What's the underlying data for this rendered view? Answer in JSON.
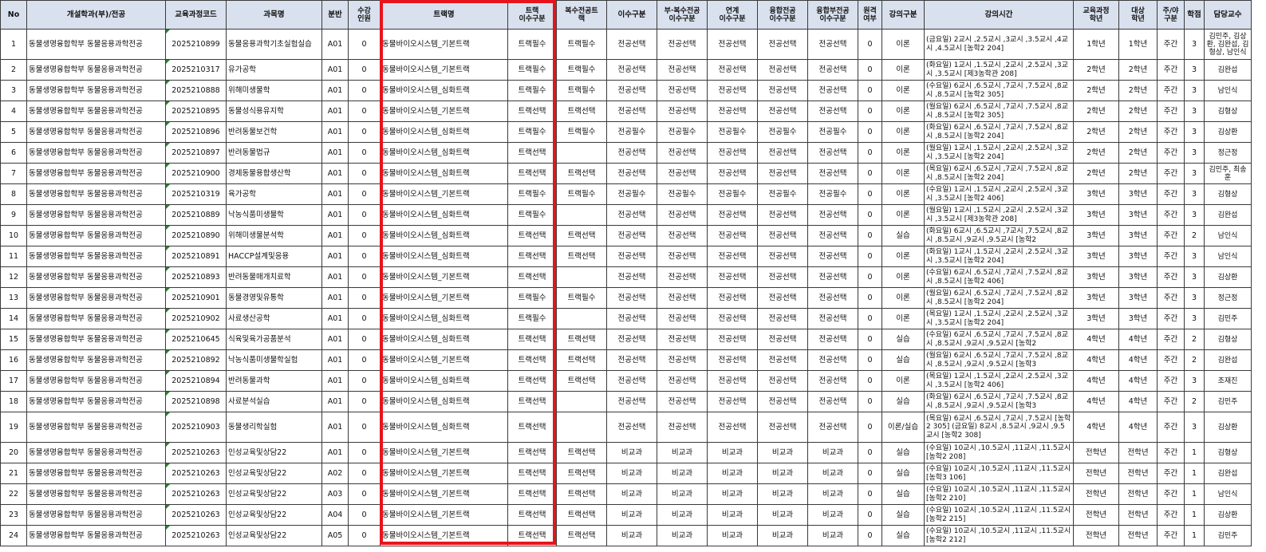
{
  "headers": [
    "No",
    "개설학과(부)/전공",
    "교육과정코드",
    "과목명",
    "분반",
    "수강\n인원",
    "트랙명",
    "트랙\n이수구분",
    "복수전공트\n랙",
    "이수구분",
    "부·복수전공\n이수구분",
    "연계\n이수구분",
    "융합전공\n이수구분",
    "융합부전공\n이수구분",
    "원격\n여부",
    "강의구분",
    "강의시간",
    "교육과정\n학년",
    "대상\n학년",
    "주/야\n구분",
    "학점",
    "담당교수"
  ],
  "rows": [
    {
      "no": "1",
      "dept": "동물생명융합학부 동물응용과학전공",
      "code": "2025210899",
      "subject": "동물응용과학기초실험실습",
      "section": "A01",
      "enroll": "0",
      "track": "동물바이오시스템_기본트랙",
      "track_type": "트랙필수",
      "dual_track": "트랙필수",
      "type": "전공선택",
      "minor_type": "전공선택",
      "linked_type": "전공선택",
      "fusion_type": "전공선택",
      "fusion_minor_type": "전공선택",
      "remote": "0",
      "lecture_type": "이론",
      "time": "(금요일) 2교시 ,2.5교시 ,3교시 ,3.5교시 ,4교시 ,4.5교시 [농학2 204]",
      "curr_year": "1학년",
      "target_year": "1학년",
      "daynight": "주간",
      "credit": "3",
      "professor": "김민주, 김상환, 김완섭, 김형상, 남인식"
    },
    {
      "no": "2",
      "dept": "동물생명융합학부 동물응용과학전공",
      "code": "2025210317",
      "subject": "유가공학",
      "section": "A01",
      "enroll": "0",
      "track": "동물바이오시스템_기본트랙",
      "track_type": "트랙필수",
      "dual_track": "트랙필수",
      "type": "전공선택",
      "minor_type": "전공선택",
      "linked_type": "전공선택",
      "fusion_type": "전공선택",
      "fusion_minor_type": "전공선택",
      "remote": "0",
      "lecture_type": "이론",
      "time": "(화요일) 1교시 ,1.5교시 ,2교시 ,2.5교시 ,3교시 ,3.5교시 [제3농학관 208]",
      "curr_year": "2학년",
      "target_year": "2학년",
      "daynight": "주간",
      "credit": "3",
      "professor": "김완섭"
    },
    {
      "no": "3",
      "dept": "동물생명융합학부 동물응용과학전공",
      "code": "2025210888",
      "subject": "위해미생물학",
      "section": "A01",
      "enroll": "0",
      "track": "동물바이오시스템_심화트랙",
      "track_type": "트랙필수",
      "dual_track": "트랙필수",
      "type": "전공선택",
      "minor_type": "전공선택",
      "linked_type": "전공선택",
      "fusion_type": "전공선택",
      "fusion_minor_type": "전공선택",
      "remote": "0",
      "lecture_type": "이론",
      "time": "(수요일) 6교시 ,6.5교시 ,7교시 ,7.5교시 ,8교시 ,8.5교시 [농학2 305]",
      "curr_year": "2학년",
      "target_year": "2학년",
      "daynight": "주간",
      "credit": "3",
      "professor": "남인식"
    },
    {
      "no": "4",
      "dept": "동물생명융합학부 동물응용과학전공",
      "code": "2025210895",
      "subject": "동물성식용유지학",
      "section": "A01",
      "enroll": "0",
      "track": "동물바이오시스템_기본트랙",
      "track_type": "트랙선택",
      "dual_track": "트랙선택",
      "type": "전공선택",
      "minor_type": "전공선택",
      "linked_type": "전공선택",
      "fusion_type": "전공선택",
      "fusion_minor_type": "전공선택",
      "remote": "0",
      "lecture_type": "이론",
      "time": "(월요일) 6교시 ,6.5교시 ,7교시 ,7.5교시 ,8교시 ,8.5교시 [농학2 305]",
      "curr_year": "2학년",
      "target_year": "2학년",
      "daynight": "주간",
      "credit": "3",
      "professor": "김형상"
    },
    {
      "no": "5",
      "dept": "동물생명융합학부 동물응용과학전공",
      "code": "2025210896",
      "subject": "반려동물보건학",
      "section": "A01",
      "enroll": "0",
      "track": "동물바이오시스템_심화트랙",
      "track_type": "트랙필수",
      "dual_track": "트랙필수",
      "type": "전공필수",
      "minor_type": "전공필수",
      "linked_type": "전공필수",
      "fusion_type": "전공필수",
      "fusion_minor_type": "전공필수",
      "remote": "0",
      "lecture_type": "이론",
      "time": "(화요일) 6교시 ,6.5교시 ,7교시 ,7.5교시 ,8교시 ,8.5교시 [농학2 204]",
      "curr_year": "2학년",
      "target_year": "2학년",
      "daynight": "주간",
      "credit": "3",
      "professor": "김상환"
    },
    {
      "no": "6",
      "dept": "동물생명융합학부 동물응용과학전공",
      "code": "2025210897",
      "subject": "반려동물법규",
      "section": "A01",
      "enroll": "0",
      "track": "동물바이오시스템_심화트랙",
      "track_type": "트랙선택",
      "dual_track": "",
      "type": "전공선택",
      "minor_type": "전공선택",
      "linked_type": "전공선택",
      "fusion_type": "전공선택",
      "fusion_minor_type": "전공선택",
      "remote": "0",
      "lecture_type": "이론",
      "time": "(월요일) 1교시 ,1.5교시 ,2교시 ,2.5교시 ,3교시 ,3.5교시 [농학2 204]",
      "curr_year": "2학년",
      "target_year": "2학년",
      "daynight": "주간",
      "credit": "3",
      "professor": "정근정"
    },
    {
      "no": "7",
      "dept": "동물생명융합학부 동물응용과학전공",
      "code": "2025210900",
      "subject": "경제동물용합생산학",
      "section": "A01",
      "enroll": "0",
      "track": "동물바이오시스템_심화트랙",
      "track_type": "트랙선택",
      "dual_track": "트랙선택",
      "type": "전공선택",
      "minor_type": "전공선택",
      "linked_type": "전공선택",
      "fusion_type": "전공선택",
      "fusion_minor_type": "전공선택",
      "remote": "0",
      "lecture_type": "이론",
      "time": "(목요일) 6교시 ,6.5교시 ,7교시 ,7.5교시 ,8교시 ,8.5교시 [농학2 204]",
      "curr_year": "2학년",
      "target_year": "2학년",
      "daynight": "주간",
      "credit": "3",
      "professor": "김민주, 최송훈"
    },
    {
      "no": "8",
      "dept": "동물생명융합학부 동물응용과학전공",
      "code": "2025210319",
      "subject": "육가공학",
      "section": "A01",
      "enroll": "0",
      "track": "동물바이오시스템_기본트랙",
      "track_type": "트랙필수",
      "dual_track": "트랙필수",
      "type": "전공필수",
      "minor_type": "전공필수",
      "linked_type": "전공필수",
      "fusion_type": "전공필수",
      "fusion_minor_type": "전공필수",
      "remote": "0",
      "lecture_type": "이론",
      "time": "(수요일) 1교시 ,1.5교시 ,2교시 ,2.5교시 ,3교시 ,3.5교시 [농학2 406]",
      "curr_year": "3학년",
      "target_year": "3학년",
      "daynight": "주간",
      "credit": "3",
      "professor": "김형상"
    },
    {
      "no": "9",
      "dept": "동물생명융합학부 동물응용과학전공",
      "code": "2025210889",
      "subject": "낙농식품미생물학",
      "section": "A01",
      "enroll": "0",
      "track": "동물바이오시스템_심화트랙",
      "track_type": "트랙필수",
      "dual_track": "",
      "type": "전공선택",
      "minor_type": "전공선택",
      "linked_type": "전공선택",
      "fusion_type": "전공선택",
      "fusion_minor_type": "전공선택",
      "remote": "0",
      "lecture_type": "이론",
      "time": "(월요일) 1교시 ,1.5교시 ,2교시 ,2.5교시 ,3교시 ,3.5교시 [제3농학관 208]",
      "curr_year": "3학년",
      "target_year": "3학년",
      "daynight": "주간",
      "credit": "3",
      "professor": "김완섭"
    },
    {
      "no": "10",
      "dept": "동물생명융합학부 동물응용과학전공",
      "code": "2025210890",
      "subject": "위해미생물분석학",
      "section": "A01",
      "enroll": "0",
      "track": "동물바이오시스템_심화트랙",
      "track_type": "트랙선택",
      "dual_track": "트랙선택",
      "type": "전공선택",
      "minor_type": "전공선택",
      "linked_type": "전공선택",
      "fusion_type": "전공선택",
      "fusion_minor_type": "전공선택",
      "remote": "0",
      "lecture_type": "실습",
      "time": "(화요일) 6교시 ,6.5교시 ,7교시 ,7.5교시 ,8교시 ,8.5교시 ,9교시 ,9.5교시 [농학2",
      "curr_year": "3학년",
      "target_year": "3학년",
      "daynight": "주간",
      "credit": "2",
      "professor": "남인식"
    },
    {
      "no": "11",
      "dept": "동물생명융합학부 동물응용과학전공",
      "code": "2025210891",
      "subject": "HACCP설계및응용",
      "section": "A01",
      "enroll": "0",
      "track": "동물바이오시스템_심화트랙",
      "track_type": "트랙선택",
      "dual_track": "트랙선택",
      "type": "전공선택",
      "minor_type": "전공선택",
      "linked_type": "전공선택",
      "fusion_type": "전공선택",
      "fusion_minor_type": "전공선택",
      "remote": "0",
      "lecture_type": "이론",
      "time": "(화요일) 1교시 ,1.5교시 ,2교시 ,2.5교시 ,3교시 ,3.5교시 [농학2 204]",
      "curr_year": "3학년",
      "target_year": "3학년",
      "daynight": "주간",
      "credit": "3",
      "professor": "남인식"
    },
    {
      "no": "12",
      "dept": "동물생명융합학부 동물응용과학전공",
      "code": "2025210893",
      "subject": "반려동물매개치료학",
      "section": "A01",
      "enroll": "0",
      "track": "동물바이오시스템_기본트랙",
      "track_type": "트랙선택",
      "dual_track": "",
      "type": "전공선택",
      "minor_type": "전공선택",
      "linked_type": "전공선택",
      "fusion_type": "전공선택",
      "fusion_minor_type": "전공선택",
      "remote": "0",
      "lecture_type": "이론",
      "time": "(수요일) 6교시 ,6.5교시 ,7교시 ,7.5교시 ,8교시 ,8.5교시 [농학2 406]",
      "curr_year": "3학년",
      "target_year": "3학년",
      "daynight": "주간",
      "credit": "3",
      "professor": "김상환"
    },
    {
      "no": "13",
      "dept": "동물생명융합학부 동물응용과학전공",
      "code": "2025210901",
      "subject": "동물경영및유통학",
      "section": "A01",
      "enroll": "0",
      "track": "동물바이오시스템_기본트랙",
      "track_type": "트랙필수",
      "dual_track": "트랙필수",
      "type": "전공선택",
      "minor_type": "전공선택",
      "linked_type": "전공선택",
      "fusion_type": "전공선택",
      "fusion_minor_type": "전공선택",
      "remote": "0",
      "lecture_type": "이론",
      "time": "(월요일) 6교시 ,6.5교시 ,7교시 ,7.5교시 ,8교시 ,8.5교시 [농학2 204]",
      "curr_year": "3학년",
      "target_year": "3학년",
      "daynight": "주간",
      "credit": "3",
      "professor": "정근정"
    },
    {
      "no": "14",
      "dept": "동물생명융합학부 동물응용과학전공",
      "code": "2025210902",
      "subject": "사료생산공학",
      "section": "A01",
      "enroll": "0",
      "track": "동물바이오시스템_심화트랙",
      "track_type": "트랙필수",
      "dual_track": "",
      "type": "전공선택",
      "minor_type": "전공선택",
      "linked_type": "전공선택",
      "fusion_type": "전공선택",
      "fusion_minor_type": "전공선택",
      "remote": "0",
      "lecture_type": "이론",
      "time": "(목요일) 1교시 ,1.5교시 ,2교시 ,2.5교시 ,3교시 ,3.5교시 [농학2 204]",
      "curr_year": "3학년",
      "target_year": "3학년",
      "daynight": "주간",
      "credit": "3",
      "professor": "김민주"
    },
    {
      "no": "15",
      "dept": "동물생명융합학부 동물응용과학전공",
      "code": "2025210645",
      "subject": "식육및육가공품분석",
      "section": "A01",
      "enroll": "0",
      "track": "동물바이오시스템_심화트랙",
      "track_type": "트랙선택",
      "dual_track": "트랙선택",
      "type": "전공선택",
      "minor_type": "전공선택",
      "linked_type": "전공선택",
      "fusion_type": "전공선택",
      "fusion_minor_type": "전공선택",
      "remote": "0",
      "lecture_type": "실습",
      "time": "(수요일) 6교시 ,6.5교시 ,7교시 ,7.5교시 ,8교시 ,8.5교시 ,9교시 ,9.5교시 [농학2",
      "curr_year": "4학년",
      "target_year": "4학년",
      "daynight": "주간",
      "credit": "2",
      "professor": "김형상"
    },
    {
      "no": "16",
      "dept": "동물생명융합학부 동물응용과학전공",
      "code": "2025210892",
      "subject": "낙농식품미생물학실험",
      "section": "A01",
      "enroll": "0",
      "track": "동물바이오시스템_기본트랙",
      "track_type": "트랙선택",
      "dual_track": "트랙선택",
      "type": "전공선택",
      "minor_type": "전공선택",
      "linked_type": "전공선택",
      "fusion_type": "전공선택",
      "fusion_minor_type": "전공선택",
      "remote": "0",
      "lecture_type": "실습",
      "time": "(월요일) 6교시 ,6.5교시 ,7교시 ,7.5교시 ,8교시 ,8.5교시 ,9교시 ,9.5교시 [농학3",
      "curr_year": "4학년",
      "target_year": "4학년",
      "daynight": "주간",
      "credit": "2",
      "professor": "김완섭"
    },
    {
      "no": "17",
      "dept": "동물생명융합학부 동물응용과학전공",
      "code": "2025210894",
      "subject": "반려동물과학",
      "section": "A01",
      "enroll": "0",
      "track": "동물바이오시스템_심화트랙",
      "track_type": "트랙선택",
      "dual_track": "트랙선택",
      "type": "전공선택",
      "minor_type": "전공선택",
      "linked_type": "전공선택",
      "fusion_type": "전공선택",
      "fusion_minor_type": "전공선택",
      "remote": "0",
      "lecture_type": "이론",
      "time": "(목요일) 1교시 ,1.5교시 ,2교시 ,2.5교시 ,3교시 ,3.5교시 [농학2 406]",
      "curr_year": "4학년",
      "target_year": "4학년",
      "daynight": "주간",
      "credit": "3",
      "professor": "조재진"
    },
    {
      "no": "18",
      "dept": "동물생명융합학부 동물응용과학전공",
      "code": "2025210898",
      "subject": "사료분석실습",
      "section": "A01",
      "enroll": "0",
      "track": "동물바이오시스템_심화트랙",
      "track_type": "트랙선택",
      "dual_track": "",
      "type": "전공선택",
      "minor_type": "전공선택",
      "linked_type": "전공선택",
      "fusion_type": "전공선택",
      "fusion_minor_type": "전공선택",
      "remote": "0",
      "lecture_type": "실습",
      "time": "(화요일) 6교시 ,6.5교시 ,7교시 ,7.5교시 ,8교시 ,8.5교시 ,9교시 ,9.5교시 [농학3",
      "curr_year": "4학년",
      "target_year": "4학년",
      "daynight": "주간",
      "credit": "2",
      "professor": "김민주"
    },
    {
      "no": "19",
      "dept": "동물생명융합학부 동물응용과학전공",
      "code": "2025210903",
      "subject": "동물생리학실험",
      "section": "A01",
      "enroll": "0",
      "track": "동물바이오시스템_심화트랙",
      "track_type": "트랙선택",
      "dual_track": "",
      "type": "전공선택",
      "minor_type": "전공선택",
      "linked_type": "전공선택",
      "fusion_type": "전공선택",
      "fusion_minor_type": "전공선택",
      "remote": "0",
      "lecture_type": "이론/실습",
      "time": "(목요일) 6교시 ,6.5교시 ,7교시 ,7.5교시 [농학2 305] (금요일) 8교시 ,8.5교시 ,9교시 ,9.5교시 [농학2 308]",
      "curr_year": "4학년",
      "target_year": "4학년",
      "daynight": "주간",
      "credit": "3",
      "professor": "김상환"
    },
    {
      "no": "20",
      "dept": "동물생명융합학부 동물응용과학전공",
      "code": "2025210263",
      "subject": "인성교육및상담22",
      "section": "A01",
      "enroll": "0",
      "track": "동물바이오시스템_기본트랙",
      "track_type": "트랙선택",
      "dual_track": "트랙선택",
      "type": "비교과",
      "minor_type": "비교과",
      "linked_type": "비교과",
      "fusion_type": "비교과",
      "fusion_minor_type": "비교과",
      "remote": "0",
      "lecture_type": "실습",
      "time": "(수요일) 10교시 ,10.5교시 ,11교시 ,11.5교시 [농학2 208]",
      "curr_year": "전학년",
      "target_year": "전학년",
      "daynight": "주간",
      "credit": "1",
      "professor": "김형상"
    },
    {
      "no": "21",
      "dept": "동물생명융합학부 동물응용과학전공",
      "code": "2025210263",
      "subject": "인성교육및상담22",
      "section": "A02",
      "enroll": "0",
      "track": "동물바이오시스템_기본트랙",
      "track_type": "트랙선택",
      "dual_track": "트랙선택",
      "type": "비교과",
      "minor_type": "비교과",
      "linked_type": "비교과",
      "fusion_type": "비교과",
      "fusion_minor_type": "비교과",
      "remote": "0",
      "lecture_type": "실습",
      "time": "(수요일) 10교시 ,10.5교시 ,11교시 ,11.5교시 [농학3 106]",
      "curr_year": "전학년",
      "target_year": "전학년",
      "daynight": "주간",
      "credit": "1",
      "professor": "김완섭"
    },
    {
      "no": "22",
      "dept": "동물생명융합학부 동물응용과학전공",
      "code": "2025210263",
      "subject": "인성교육및상담22",
      "section": "A03",
      "enroll": "0",
      "track": "동물바이오시스템_기본트랙",
      "track_type": "트랙선택",
      "dual_track": "트랙선택",
      "type": "비교과",
      "minor_type": "비교과",
      "linked_type": "비교과",
      "fusion_type": "비교과",
      "fusion_minor_type": "비교과",
      "remote": "0",
      "lecture_type": "실습",
      "time": "(수요일) 10교시 ,10.5교시 ,11교시 ,11.5교시 [농학2 210]",
      "curr_year": "전학년",
      "target_year": "전학년",
      "daynight": "주간",
      "credit": "1",
      "professor": "남인식"
    },
    {
      "no": "23",
      "dept": "동물생명융합학부 동물응용과학전공",
      "code": "2025210263",
      "subject": "인성교육및상담22",
      "section": "A04",
      "enroll": "0",
      "track": "동물바이오시스템_기본트랙",
      "track_type": "트랙선택",
      "dual_track": "트랙선택",
      "type": "비교과",
      "minor_type": "비교과",
      "linked_type": "비교과",
      "fusion_type": "비교과",
      "fusion_minor_type": "비교과",
      "remote": "0",
      "lecture_type": "실습",
      "time": "(수요일) 10교시 ,10.5교시 ,11교시 ,11.5교시 [농학2 215]",
      "curr_year": "전학년",
      "target_year": "전학년",
      "daynight": "주간",
      "credit": "1",
      "professor": "김상환"
    },
    {
      "no": "24",
      "dept": "동물생명융합학부 동물응용과학전공",
      "code": "2025210263",
      "subject": "인성교육및상담22",
      "section": "A05",
      "enroll": "0",
      "track": "동물바이오시스템_기본트랙",
      "track_type": "트랙선택",
      "dual_track": "트랙선택",
      "type": "비교과",
      "minor_type": "비교과",
      "linked_type": "비교과",
      "fusion_type": "비교과",
      "fusion_minor_type": "비교과",
      "remote": "0",
      "lecture_type": "실습",
      "time": "(수요일) 10교시 ,10.5교시 ,11교시 ,11.5교시 [농학2 212]",
      "curr_year": "전학년",
      "target_year": "전학년",
      "daynight": "주간",
      "credit": "1",
      "professor": "김민주"
    }
  ],
  "colors": {
    "header_bg": "#d9e1ee",
    "highlight_border": "#e8141c",
    "cell_marker": "#2e7d32"
  }
}
